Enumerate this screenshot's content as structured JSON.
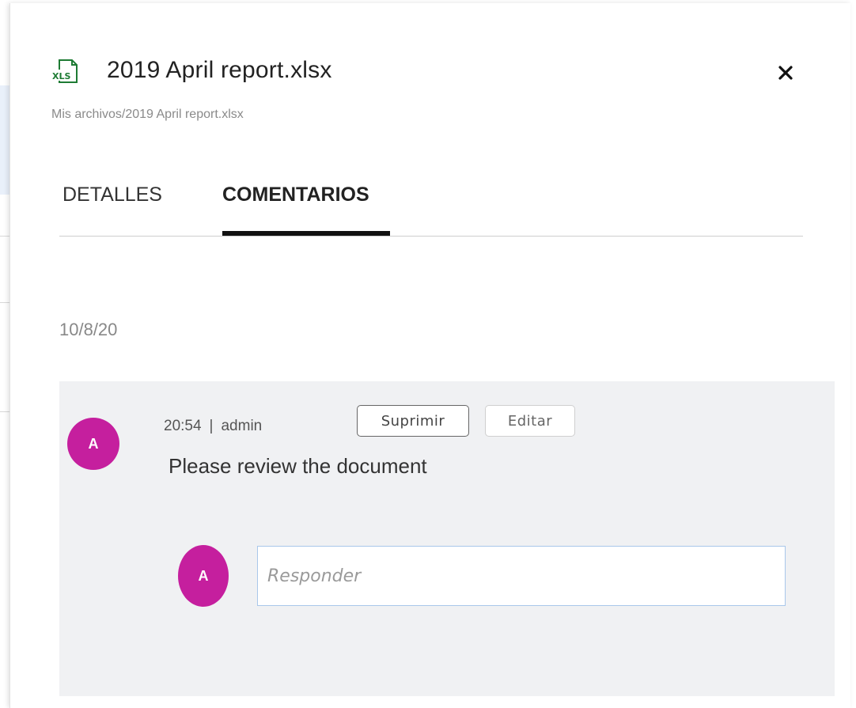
{
  "file": {
    "icon": "xls-file-icon",
    "icon_label": "XLS",
    "title": "2019 April report.xlsx",
    "path": "Mis archivos/2019 April report.xlsx"
  },
  "tabs": [
    {
      "label": "DETALLES",
      "active": false
    },
    {
      "label": "COMENTARIOS",
      "active": true
    }
  ],
  "comments": {
    "date": "10/8/20",
    "items": [
      {
        "avatar_initial": "A",
        "time": "20:54",
        "separator": "|",
        "author": "admin",
        "text": "Please review the document",
        "delete_label": "Suprimir",
        "edit_label": "Editar"
      }
    ],
    "reply": {
      "avatar_initial": "A",
      "placeholder": "Responder"
    }
  },
  "colors": {
    "avatar": "#c51f9e",
    "xls_green": "#1e7b34",
    "thread_bg": "#f0f1f3",
    "input_border": "#a9c7ea"
  }
}
